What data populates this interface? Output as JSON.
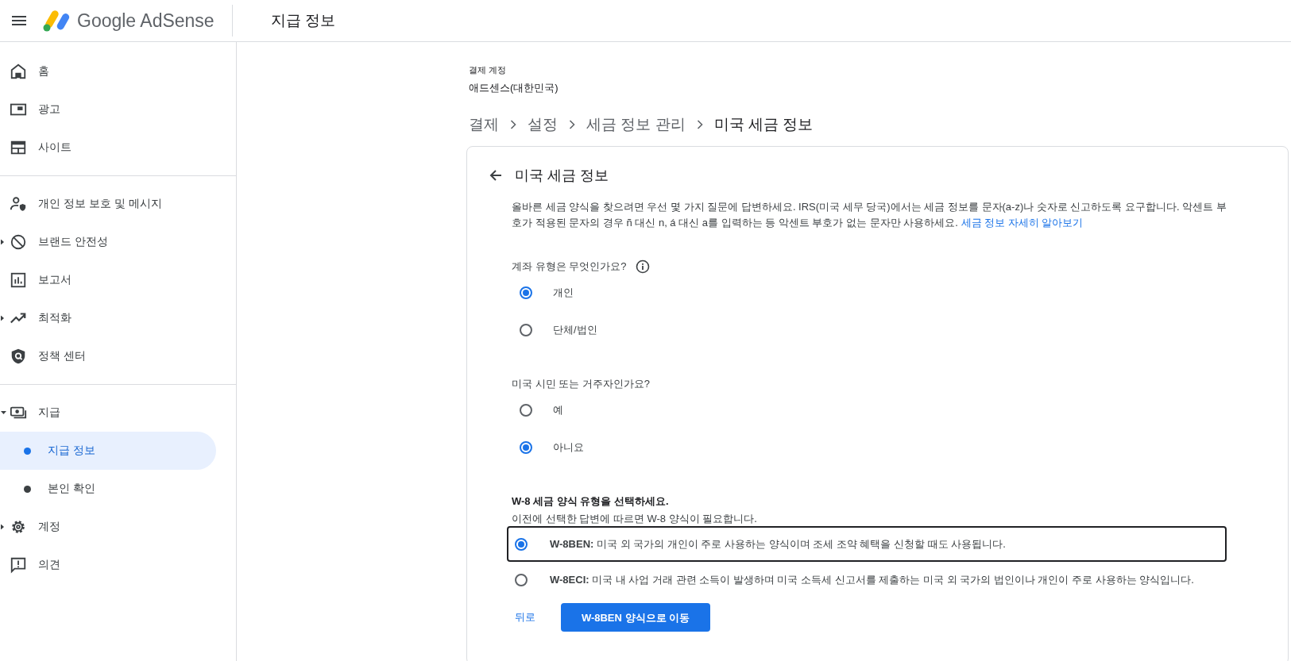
{
  "header": {
    "product": "Google AdSense",
    "page_title": "지급 정보"
  },
  "sidebar": {
    "groups": [
      {
        "items": [
          {
            "label": "홈",
            "expandable": false,
            "selected": false
          },
          {
            "label": "광고",
            "expandable": false,
            "selected": false
          },
          {
            "label": "사이트",
            "expandable": false,
            "selected": false
          }
        ]
      },
      {
        "items": [
          {
            "label": "개인 정보 보호 및 메시지",
            "expandable": false,
            "selected": false
          },
          {
            "label": "브랜드 안전성",
            "expandable": true,
            "expanded": false,
            "selected": false
          },
          {
            "label": "보고서",
            "expandable": false,
            "selected": false
          },
          {
            "label": "최적화",
            "expandable": true,
            "expanded": false,
            "selected": false
          },
          {
            "label": "정책 센터",
            "expandable": false,
            "selected": false
          }
        ]
      },
      {
        "items": [
          {
            "label": "지급",
            "expandable": true,
            "expanded": true,
            "selected": false,
            "children": [
              {
                "label": "지급 정보",
                "selected": true
              },
              {
                "label": "본인 확인",
                "selected": false
              }
            ]
          },
          {
            "label": "계정",
            "expandable": true,
            "expanded": false,
            "selected": false
          },
          {
            "label": "의견",
            "expandable": false,
            "selected": false
          }
        ]
      }
    ]
  },
  "account": {
    "label": "결제 계정",
    "name": "애드센스(대한민국)"
  },
  "breadcrumbs": [
    "결제",
    "설정",
    "세금 정보 관리",
    "미국 세금 정보"
  ],
  "card": {
    "title": "미국 세금 정보",
    "intro": "올바른 세금 양식을 찾으려면 우선 몇 가지 질문에 답변하세요. IRS(미국 세무 당국)에서는 세금 정보를 문자(a-z)나 숫자로 신고하도록 요구합니다. 악센트 부호가 적용된 문자의 경우 ñ 대신 n, á 대신 a를 입력하는 등 악센트 부호가 없는 문자만 사용하세요.",
    "link": "세금 정보 자세히 알아보기",
    "questions": [
      {
        "kind": "plain",
        "text": "계좌 유형은 무엇인가요?",
        "info": true,
        "options": [
          {
            "label": "개인",
            "selected": true
          },
          {
            "label": "단체/법인",
            "selected": false
          }
        ]
      },
      {
        "kind": "plain",
        "text": "미국 시민 또는 거주자인가요?",
        "info": false,
        "options": [
          {
            "label": "예",
            "selected": false
          },
          {
            "label": "아니요",
            "selected": true
          }
        ]
      },
      {
        "kind": "form",
        "text": "W-8 세금 양식 유형을 선택하세요.",
        "subtext": "이전에 선택한 답변에 따르면 W-8 양식이 필요합니다.",
        "info": false,
        "options": [
          {
            "label": "**W-8BEN:** 미국 외 국가의 개인이 주로 사용하는 양식이며 조세 조약 혜택을 신청할 때도 사용됩니다.",
            "selected": true
          },
          {
            "label": "**W-8ECI:** 미국 내 사업 거래 관련 소득이 발생하며 미국 소득세 신고서를 제출하는 미국 외 국가의 법인이나 개인이 주로 사용하는 양식입니다.",
            "selected": false
          }
        ]
      }
    ],
    "back_button": "뒤로",
    "next_button": "W-8BEN 양식으로 이동"
  }
}
